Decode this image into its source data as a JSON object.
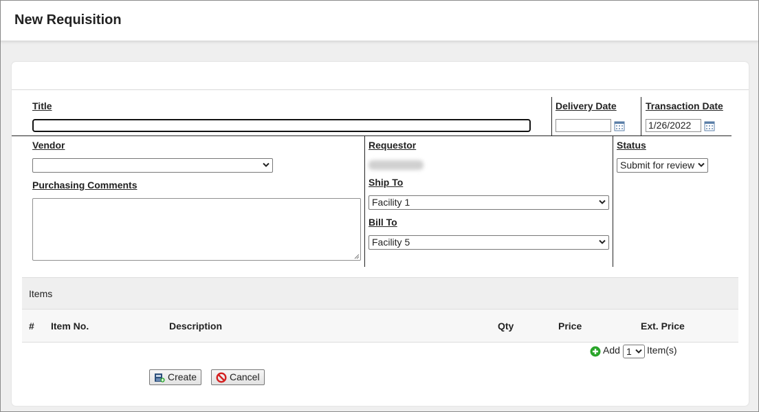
{
  "page": {
    "title": "New Requisition"
  },
  "form": {
    "title_label": "Title",
    "delivery_date_label": "Delivery Date",
    "delivery_date_value": "",
    "transaction_date_label": "Transaction Date",
    "transaction_date_value": "1/26/2022",
    "vendor_label": "Vendor",
    "vendor_value": "",
    "purchasing_comments_label": "Purchasing Comments",
    "requestor_label": "Requestor",
    "ship_to_label": "Ship To",
    "ship_to_value": "Facility 1",
    "bill_to_label": "Bill To",
    "bill_to_value": "Facility 5",
    "status_label": "Status",
    "status_value": "Submit for review"
  },
  "items": {
    "section_label": "Items",
    "columns": [
      "#",
      "Item No.",
      "Description",
      "Qty",
      "Price",
      "Ext. Price"
    ],
    "add_label": "Add",
    "add_count": "1",
    "items_suffix": "Item(s)"
  },
  "buttons": {
    "create": "Create",
    "cancel": "Cancel"
  },
  "colors": {
    "add_green": "#2aa52a",
    "cancel_red": "#d42020",
    "icon_blue": "#5b7fa8"
  }
}
